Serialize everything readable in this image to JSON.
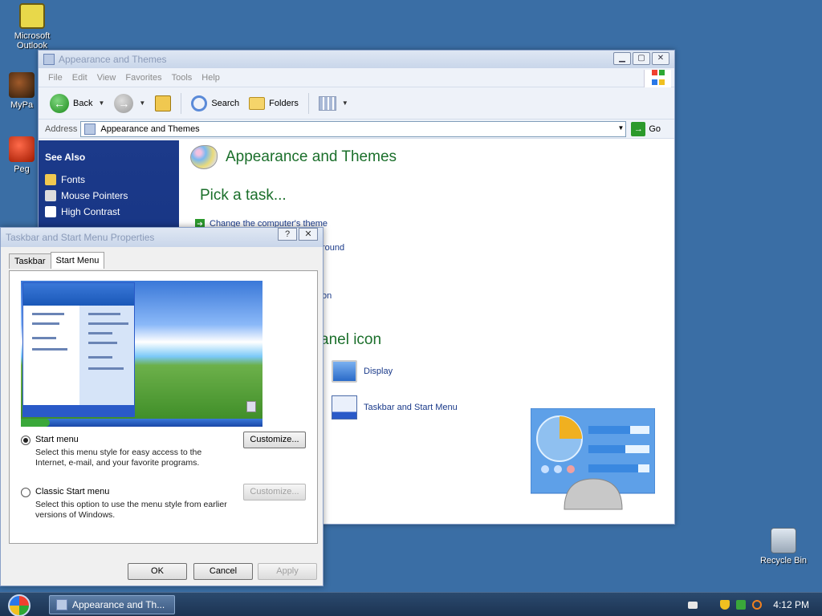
{
  "desktop": {
    "icons": [
      {
        "label": "Microsoft\nOutlook"
      },
      {
        "label": "MyPa"
      },
      {
        "label": "Peg"
      },
      {
        "label": "Recycle Bin"
      }
    ]
  },
  "explorer": {
    "title": "Appearance and Themes",
    "menu": [
      "File",
      "Edit",
      "View",
      "Favorites",
      "Tools",
      "Help"
    ],
    "toolbar": {
      "back": "Back",
      "search": "Search",
      "folders": "Folders"
    },
    "address": {
      "label": "Address",
      "value": "Appearance and Themes",
      "go": "Go"
    },
    "see_also": {
      "heading": "See Also",
      "items": [
        "Fonts",
        "Mouse Pointers",
        "High Contrast"
      ]
    },
    "main": {
      "title": "Appearance and Themes",
      "pick_task": "Pick a task...",
      "tasks": [
        "Change the computer's theme",
        "round",
        "on"
      ],
      "or_pick": "anel icon",
      "icons": [
        "Display",
        "Taskbar and Start Menu"
      ]
    }
  },
  "dialog": {
    "title": "Taskbar and Start Menu Properties",
    "help": "?",
    "close": "✕",
    "tabs": [
      "Taskbar",
      "Start Menu"
    ],
    "options": [
      {
        "label": "Start menu",
        "desc": "Select this menu style for easy access to the Internet, e-mail, and your favorite programs.",
        "selected": true,
        "button": "Customize..."
      },
      {
        "label": "Classic Start menu",
        "desc": "Select this option to use the menu style from earlier versions of Windows.",
        "selected": false,
        "button": "Customize..."
      }
    ],
    "buttons": {
      "ok": "OK",
      "cancel": "Cancel",
      "apply": "Apply"
    }
  },
  "taskbar": {
    "task": "Appearance and Th...",
    "clock": "4:12 PM"
  },
  "colors": {
    "desktop": "#3a6ea5",
    "link": "#1a3a8a",
    "heading_green": "#1b6f2b",
    "see_also_bg": "#0c2a78"
  }
}
